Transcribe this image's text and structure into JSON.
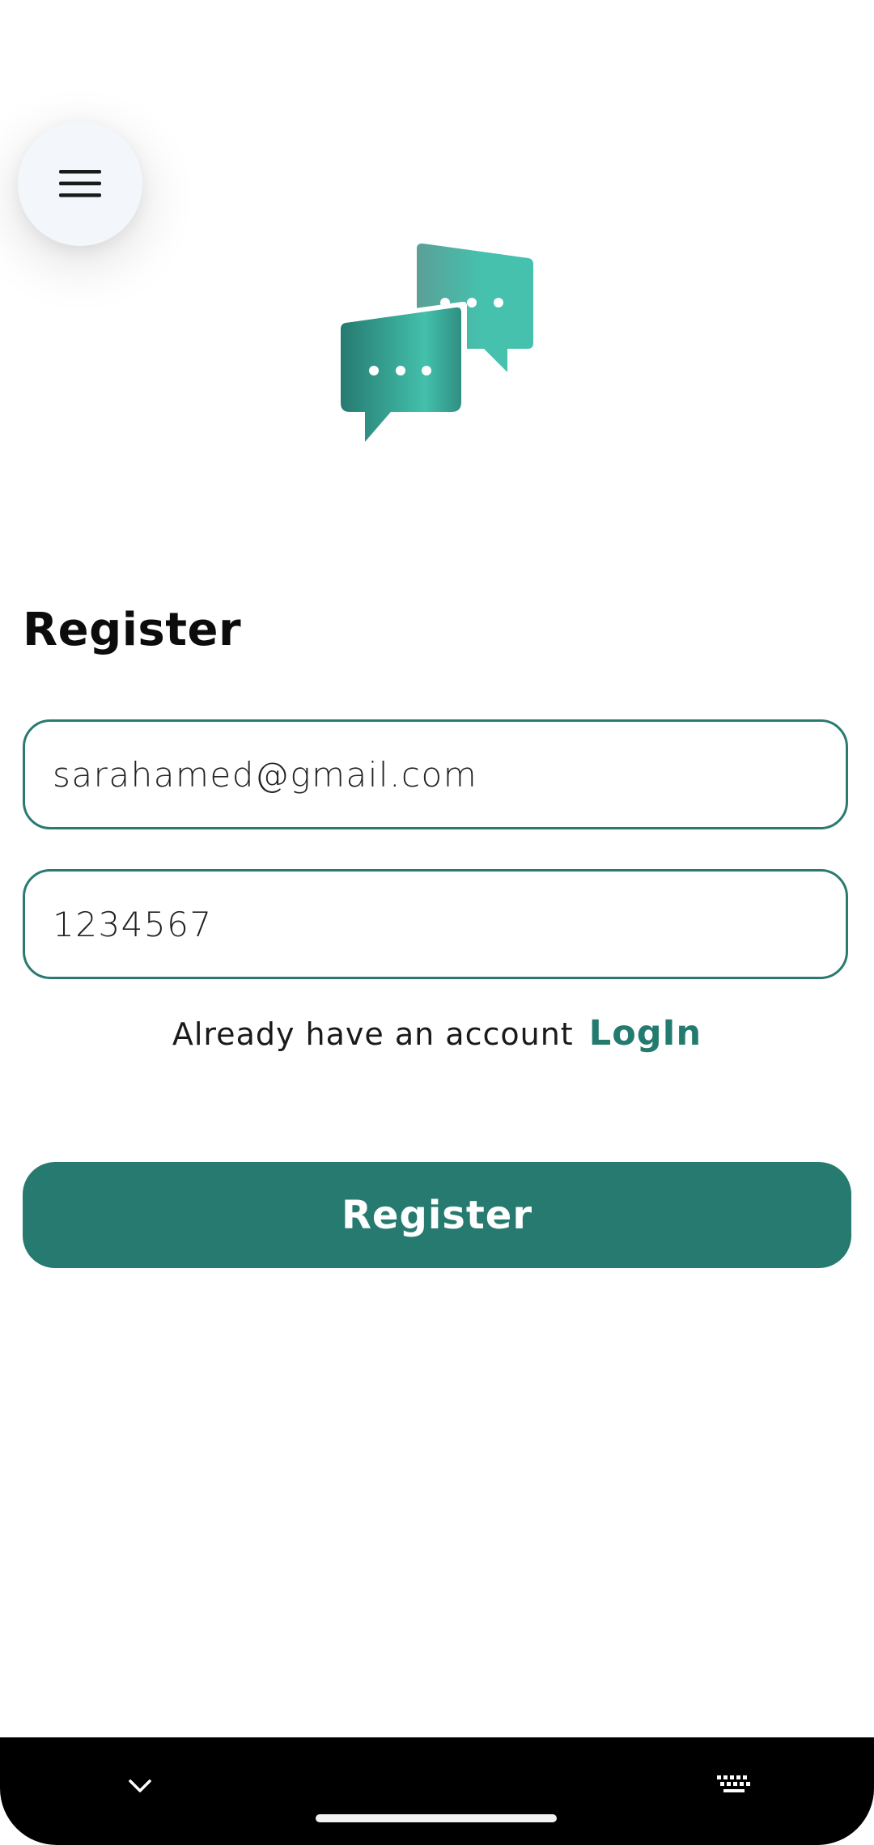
{
  "header": {
    "menu_icon": "hamburger-menu-icon",
    "logo_icon": "chat-bubbles-logo-icon"
  },
  "form": {
    "title": "Register",
    "email_value": "sarahamed@gmail.com",
    "password_value": "1234567",
    "login_prompt": "Already have an account",
    "login_link": "LogIn",
    "submit_label": "Register"
  },
  "system_nav": {
    "collapse_icon": "chevron-down-icon",
    "home_indicator": "home-indicator",
    "keyboard_icon": "keyboard-icon"
  },
  "colors": {
    "accent": "#267a70",
    "accent_light": "#45c1ad",
    "link": "#237b6f",
    "field_border": "#2a7a70",
    "menu_button_bg": "#f3f7fb",
    "nav_bar_bg": "#000000"
  }
}
